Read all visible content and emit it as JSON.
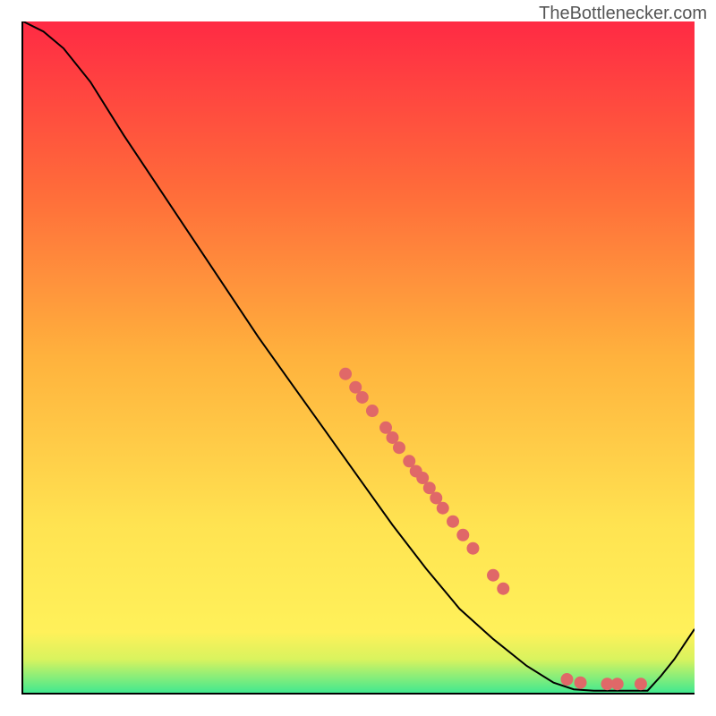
{
  "attribution": "TheBottlenecker.com",
  "chart_data": {
    "type": "line",
    "title": "",
    "xlabel": "",
    "ylabel": "",
    "xlim": [
      0,
      100
    ],
    "ylim": [
      0,
      100
    ],
    "background_gradient": {
      "stops": [
        {
          "y": 0,
          "color": "#42e88f"
        },
        {
          "y": 2,
          "color": "#7eed7d"
        },
        {
          "y": 5,
          "color": "#d9f35e"
        },
        {
          "y": 9,
          "color": "#fff15a"
        },
        {
          "y": 25,
          "color": "#ffe351"
        },
        {
          "y": 50,
          "color": "#ffb23d"
        },
        {
          "y": 75,
          "color": "#ff6b3a"
        },
        {
          "y": 100,
          "color": "#ff2a44"
        }
      ]
    },
    "series": [
      {
        "name": "curve",
        "type": "line",
        "color": "#000000",
        "points": [
          {
            "x": 0.0,
            "y": 100.0
          },
          {
            "x": 3.0,
            "y": 98.5
          },
          {
            "x": 6.0,
            "y": 96.0
          },
          {
            "x": 10.0,
            "y": 91.0
          },
          {
            "x": 15.0,
            "y": 83.0
          },
          {
            "x": 20.0,
            "y": 75.5
          },
          {
            "x": 25.0,
            "y": 68.0
          },
          {
            "x": 30.0,
            "y": 60.5
          },
          {
            "x": 35.0,
            "y": 53.0
          },
          {
            "x": 40.0,
            "y": 46.0
          },
          {
            "x": 45.0,
            "y": 39.0
          },
          {
            "x": 50.0,
            "y": 32.0
          },
          {
            "x": 55.0,
            "y": 25.0
          },
          {
            "x": 60.0,
            "y": 18.5
          },
          {
            "x": 65.0,
            "y": 12.5
          },
          {
            "x": 70.0,
            "y": 8.0
          },
          {
            "x": 75.0,
            "y": 4.0
          },
          {
            "x": 79.0,
            "y": 1.5
          },
          {
            "x": 82.0,
            "y": 0.5
          },
          {
            "x": 85.0,
            "y": 0.3
          },
          {
            "x": 88.0,
            "y": 0.3
          },
          {
            "x": 91.0,
            "y": 0.3
          },
          {
            "x": 93.0,
            "y": 0.3
          },
          {
            "x": 95.0,
            "y": 2.5
          },
          {
            "x": 97.0,
            "y": 5.0
          },
          {
            "x": 100.0,
            "y": 9.5
          }
        ]
      },
      {
        "name": "dots",
        "type": "scatter",
        "color": "#e06868",
        "points": [
          {
            "x": 48.0,
            "y": 47.5
          },
          {
            "x": 49.5,
            "y": 45.5
          },
          {
            "x": 50.5,
            "y": 44.0
          },
          {
            "x": 52.0,
            "y": 42.0
          },
          {
            "x": 54.0,
            "y": 39.5
          },
          {
            "x": 55.0,
            "y": 38.0
          },
          {
            "x": 56.0,
            "y": 36.5
          },
          {
            "x": 57.5,
            "y": 34.5
          },
          {
            "x": 58.5,
            "y": 33.0
          },
          {
            "x": 59.5,
            "y": 32.0
          },
          {
            "x": 60.5,
            "y": 30.5
          },
          {
            "x": 61.5,
            "y": 29.0
          },
          {
            "x": 62.5,
            "y": 27.5
          },
          {
            "x": 64.0,
            "y": 25.5
          },
          {
            "x": 65.5,
            "y": 23.5
          },
          {
            "x": 67.0,
            "y": 21.5
          },
          {
            "x": 70.0,
            "y": 17.5
          },
          {
            "x": 71.5,
            "y": 15.5
          },
          {
            "x": 81.0,
            "y": 2.0
          },
          {
            "x": 83.0,
            "y": 1.5
          },
          {
            "x": 87.0,
            "y": 1.3
          },
          {
            "x": 88.5,
            "y": 1.3
          },
          {
            "x": 92.0,
            "y": 1.3
          }
        ]
      }
    ]
  }
}
